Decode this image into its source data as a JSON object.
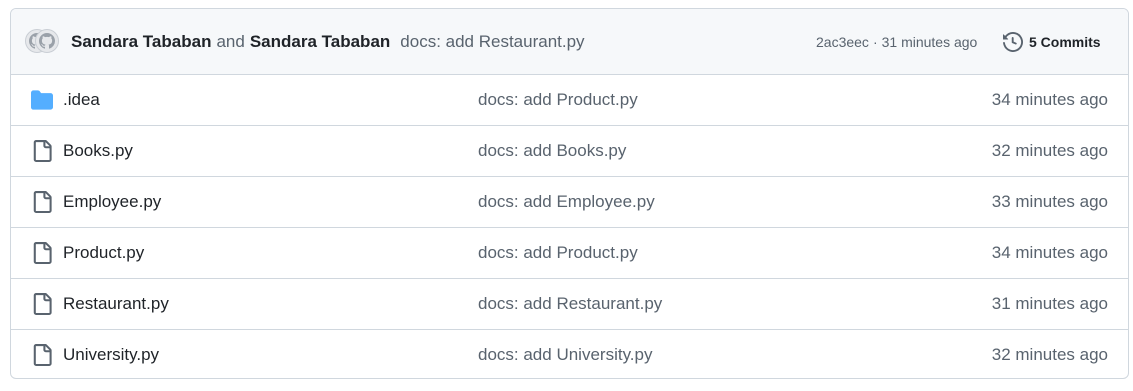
{
  "commit_header": {
    "author1": "Sandara Tababan",
    "and": "and",
    "author2": "Sandara Tababan",
    "message": "docs: add Restaurant.py",
    "hash": "2ac3eec",
    "separator": "·",
    "time": "31 minutes ago",
    "commits_label": "5 Commits"
  },
  "files": [
    {
      "name": ".idea",
      "type": "folder",
      "icon": "folder-icon",
      "message": "docs: add Product.py",
      "age": "34 minutes ago"
    },
    {
      "name": "Books.py",
      "type": "file",
      "icon": "file-icon",
      "message": "docs: add Books.py",
      "age": "32 minutes ago"
    },
    {
      "name": "Employee.py",
      "type": "file",
      "icon": "file-icon",
      "message": "docs: add Employee.py",
      "age": "33 minutes ago"
    },
    {
      "name": "Product.py",
      "type": "file",
      "icon": "file-icon",
      "message": "docs: add Product.py",
      "age": "34 minutes ago"
    },
    {
      "name": "Restaurant.py",
      "type": "file",
      "icon": "file-icon",
      "message": "docs: add Restaurant.py",
      "age": "31 minutes ago"
    },
    {
      "name": "University.py",
      "type": "file",
      "icon": "file-icon",
      "message": "docs: add University.py",
      "age": "32 minutes ago"
    }
  ],
  "colors": {
    "folder": "#54aeff",
    "file_icon": "#59636e",
    "header_bg": "#f6f8fa",
    "border": "#d0d7de"
  }
}
